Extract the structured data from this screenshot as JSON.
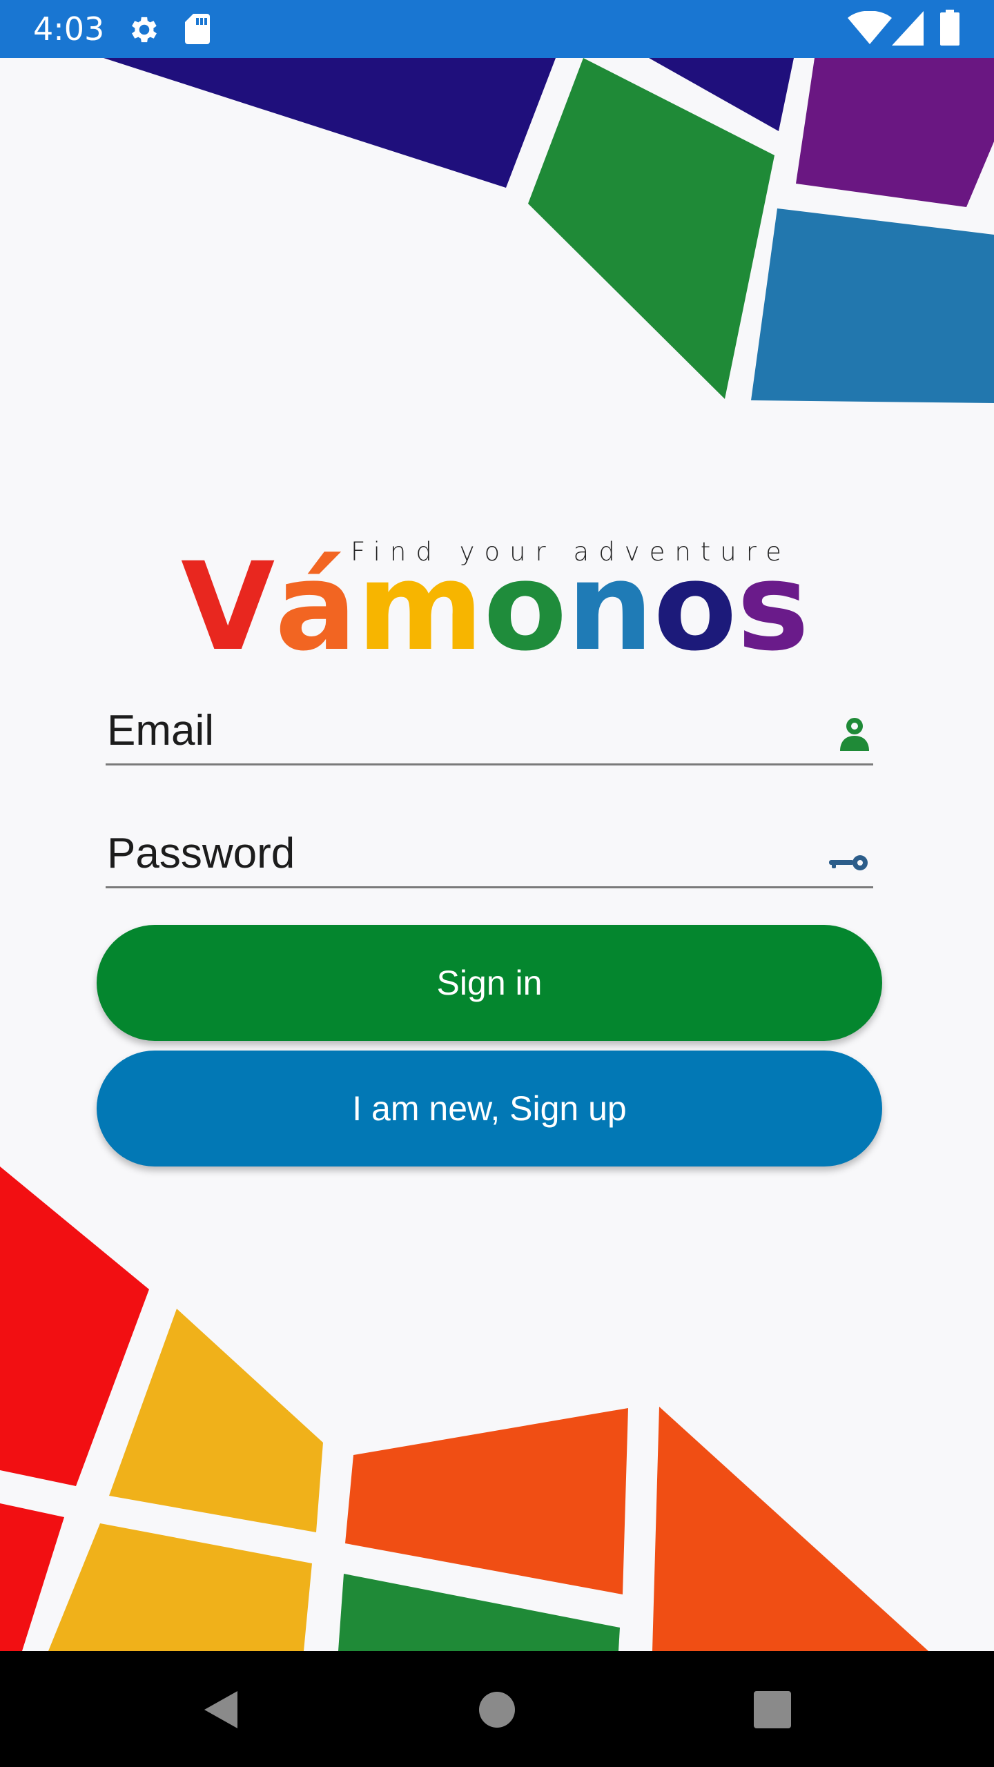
{
  "status_bar": {
    "time": "4:03",
    "icons": [
      "gear-icon",
      "sd-card-icon",
      "wifi-icon",
      "signal-icon",
      "battery-icon"
    ],
    "color": "#1976d2"
  },
  "logo": {
    "tagline": "Find your adventure",
    "letters": [
      "V",
      "á",
      "m",
      "o",
      "n",
      "o",
      "s"
    ],
    "colors": [
      "#e8271f",
      "#f26522",
      "#f7b500",
      "#1f8c3b",
      "#1f7bb6",
      "#1c1a7a",
      "#6a1b8a"
    ]
  },
  "form": {
    "email_placeholder": "Email",
    "password_placeholder": "Password",
    "email_icon": "person-icon",
    "password_icon": "key-icon"
  },
  "buttons": {
    "sign_in": "Sign in",
    "sign_up": "I am new, Sign up",
    "sign_in_color": "#04862e",
    "sign_up_color": "#0278b5"
  },
  "nav_bar": {
    "icons": [
      "back-icon",
      "home-icon",
      "recents-icon"
    ]
  }
}
